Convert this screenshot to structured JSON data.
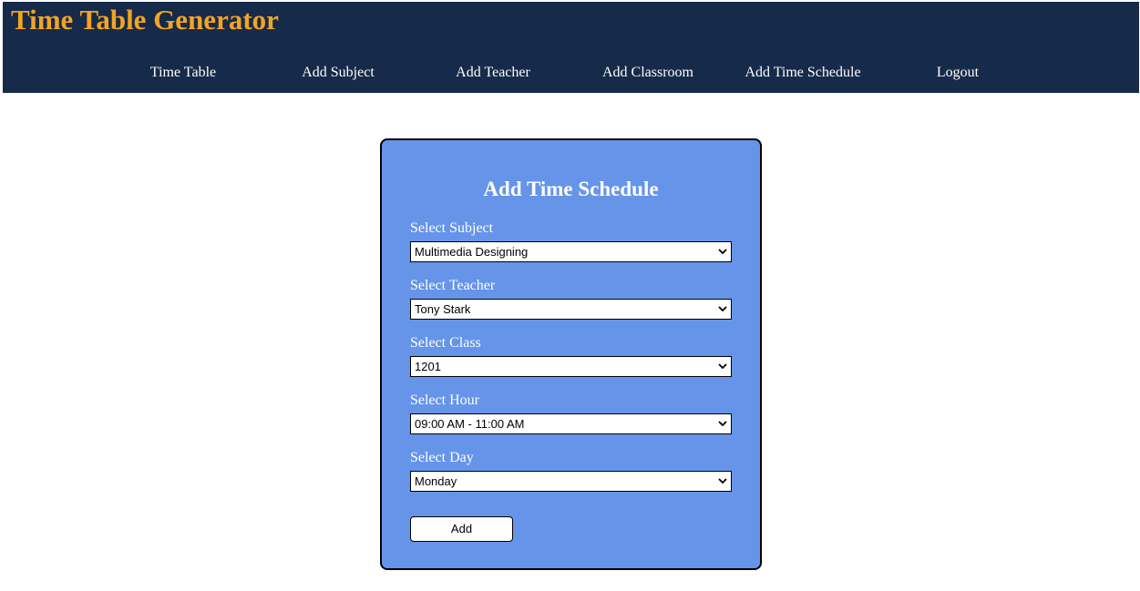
{
  "app": {
    "title": "Time Table Generator"
  },
  "nav": {
    "items": [
      {
        "label": "Time Table"
      },
      {
        "label": "Add Subject"
      },
      {
        "label": "Add Teacher"
      },
      {
        "label": "Add Classroom"
      },
      {
        "label": "Add Time Schedule"
      },
      {
        "label": "Logout"
      }
    ]
  },
  "form": {
    "title": "Add Time Schedule",
    "fields": {
      "subject": {
        "label": "Select Subject",
        "value": "Multimedia Designing"
      },
      "teacher": {
        "label": "Select Teacher",
        "value": "Tony Stark"
      },
      "class": {
        "label": "Select Class",
        "value": "1201"
      },
      "hour": {
        "label": "Select Hour",
        "value": "09:00 AM - 11:00 AM"
      },
      "day": {
        "label": "Select Day",
        "value": "Monday"
      }
    },
    "submit_label": "Add"
  },
  "colors": {
    "header_bg": "#162a49",
    "brand": "#f4a322",
    "card_bg": "#6694e9",
    "text_light": "#ffffff"
  },
  "icons": {
    "select_arrow": "chevron-down-icon"
  }
}
